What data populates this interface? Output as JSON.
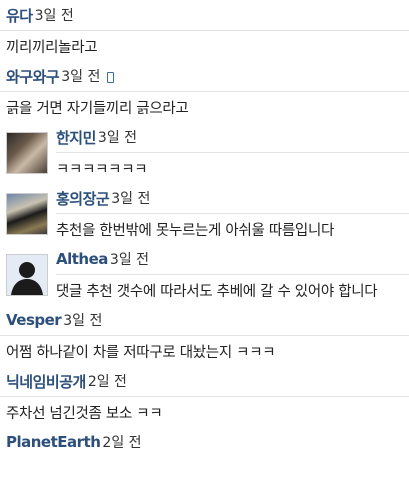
{
  "comments": [
    {
      "author": "유다",
      "time": "3일 전",
      "text": "끼리끼리놀라고"
    },
    {
      "author": "와구와구",
      "time": "3일 전",
      "mobile": true,
      "text": "긁을 거면 자기들끼리 긁으라고"
    },
    {
      "author": "한지민",
      "time": "3일 전",
      "avatar": "photo",
      "text": "ㅋㅋㅋㅋㅋㅋㅋ"
    },
    {
      "author": "홍의장군",
      "time": "3일 전",
      "avatar": "photo",
      "text": "추천을 한번밖에 못누르는게 아쉬울 따름입니다"
    },
    {
      "author": "Althea",
      "time": "3일 전",
      "avatar": "default",
      "text": "댓글 추천 갯수에 따라서도 추베에 갈 수 있어야 합니다"
    },
    {
      "author": "Vesper",
      "time": "3일 전",
      "text": "어쩜 하나같이 차를 저따구로 대놨는지 ㅋㅋㅋ"
    },
    {
      "author": "닉네임비공개",
      "time": "2일 전",
      "text": "주차선 넘긴것좀 보소 ㅋㅋ"
    },
    {
      "author": "PlanetEarth",
      "time": "2일 전",
      "text": ""
    }
  ],
  "icons": {
    "mobile": "mobile-phone-icon",
    "default_avatar": "default-user-avatar-icon"
  },
  "colors": {
    "author": "#2c4f7c",
    "divider": "#e3e3e3",
    "text": "#222222"
  }
}
